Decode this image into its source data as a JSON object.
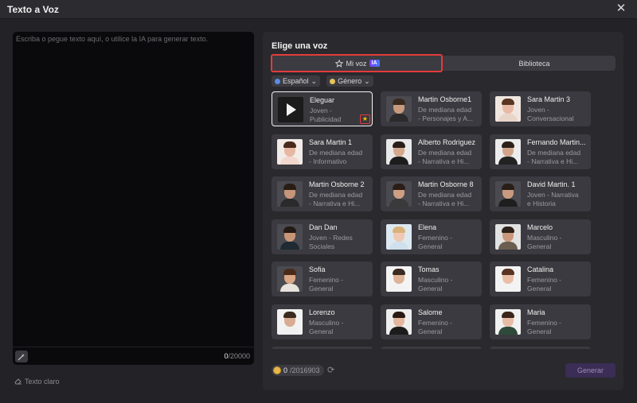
{
  "window": {
    "title": "Texto a Voz",
    "close_icon": "close-icon"
  },
  "editor": {
    "placeholder": "Escriba o pegue texto aquí, o utilice la IA para generar texto.",
    "count_current": "0",
    "count_max": "/20000",
    "magic_icon": "magic-wand-icon"
  },
  "clear": {
    "label": "Texto claro",
    "icon": "eraser-icon"
  },
  "voices": {
    "heading": "Elige una voz",
    "tab_my": "Mi voz",
    "tab_my_badge": "IA",
    "tab_library": "Biblioteca",
    "filter_language": "Español",
    "filter_gender": "Género",
    "cards": [
      {
        "name": "Eleguar",
        "desc1": "Joven -",
        "desc2": "Publicidad",
        "selected": true,
        "starred": true,
        "skin": "#2d2d2d",
        "shirt": "#121212"
      },
      {
        "name": "Martin Osborne1",
        "desc1": "De mediana edad",
        "desc2": "- Personajes y A...",
        "skin": "#c99a7d",
        "shirt": "#2b2b2b",
        "hair": "#3a2a1f"
      },
      {
        "name": "Sara Martin 3",
        "desc1": "Joven -",
        "desc2": "Conversacional",
        "skin": "#e8b9a5",
        "shirt": "#e9d4c8",
        "hair": "#5a3522",
        "bg": "#f0e6e0"
      },
      {
        "name": "Sara Martin 1",
        "desc1": "De mediana edad",
        "desc2": "- Informativo",
        "skin": "#e6b8a3",
        "shirt": "#f1d7cd",
        "hair": "#4a2a1c",
        "bg": "#f3ebe7"
      },
      {
        "name": "Alberto Rodriguez",
        "desc1": "De mediana edad",
        "desc2": "- Narrativa e Hi...",
        "skin": "#d4a88c",
        "shirt": "#1d1d1d",
        "hair": "#2a1f18",
        "bg": "#e9e9e9"
      },
      {
        "name": "Fernando Martin...",
        "desc1": "De mediana edad",
        "desc2": "- Narrativa e Hi...",
        "skin": "#d2a58a",
        "shirt": "#222222",
        "hair": "#2c2119",
        "bg": "#ececec"
      },
      {
        "name": "Martin Osborne 2",
        "desc1": "De mediana edad",
        "desc2": "- Narrativa e Hi...",
        "skin": "#c8957a",
        "shirt": "#2a2a2a",
        "hair": "#2a1d15"
      },
      {
        "name": "Martin Osborne 8",
        "desc1": "De mediana edad",
        "desc2": "- Narrativa e Hi...",
        "skin": "#cf9f84",
        "shirt": "#3a3a3a",
        "hair": "#2b1e16"
      },
      {
        "name": "David Martin. 1",
        "desc1": "Joven - Narrativa",
        "desc2": "e Historia",
        "skin": "#c99a80",
        "shirt": "#1e1e1e",
        "hair": "#2a1f18"
      },
      {
        "name": "Dan Dan",
        "desc1": "Joven - Redes",
        "desc2": "Sociales",
        "skin": "#c89577",
        "shirt": "#1f2a33",
        "hair": "#241a14"
      },
      {
        "name": "Elena",
        "desc1": "Femenino -",
        "desc2": "General",
        "skin": "#f0c8b3",
        "shirt": "#cfe0ec",
        "hair": "#d9b27a",
        "bg": "#dde9f1"
      },
      {
        "name": "Marcelo",
        "desc1": "Masculino -",
        "desc2": "General",
        "skin": "#c9977c",
        "shirt": "#6b5d4f",
        "hair": "#2d2119",
        "bg": "#e2e2e2"
      },
      {
        "name": "Sofia",
        "desc1": "Femenino -",
        "desc2": "General",
        "skin": "#d9a686",
        "shirt": "#e7e2db",
        "hair": "#4b2b18"
      },
      {
        "name": "Tomas",
        "desc1": "Masculino -",
        "desc2": "General",
        "skin": "#deb398",
        "shirt": "#f2f2f2",
        "hair": "#3a2a1f",
        "bg": "#f4f4f4"
      },
      {
        "name": "Catalina",
        "desc1": "Femenino -",
        "desc2": "General",
        "skin": "#e9bea7",
        "shirt": "#f3f3f3",
        "hair": "#5a3422",
        "bg": "#f3f3f3"
      },
      {
        "name": "Lorenzo",
        "desc1": "Masculino -",
        "desc2": "General",
        "skin": "#d8ac92",
        "shirt": "#f0f0f0",
        "hair": "#3a2a1f",
        "bg": "#f2f2f2"
      },
      {
        "name": "Salome",
        "desc1": "Femenino -",
        "desc2": "General",
        "skin": "#e3b69e",
        "shirt": "#1c1c1c",
        "hair": "#2a1b12",
        "bg": "#eeeeee"
      },
      {
        "name": "Maria",
        "desc1": "Femenino -",
        "desc2": "General",
        "skin": "#e6bca5",
        "shirt": "#2e4a3a",
        "hair": "#3b2619",
        "bg": "#f1f1f1"
      }
    ]
  },
  "footer": {
    "credits_current": "0",
    "credits_total": "/2016903",
    "generate_label": "Generar",
    "refresh_icon": "refresh-icon",
    "coin_icon": "coin-icon"
  },
  "colors": {
    "accent_red": "#e43b3b",
    "generate_bg": "#3b2d55",
    "star": "#f2c200"
  }
}
